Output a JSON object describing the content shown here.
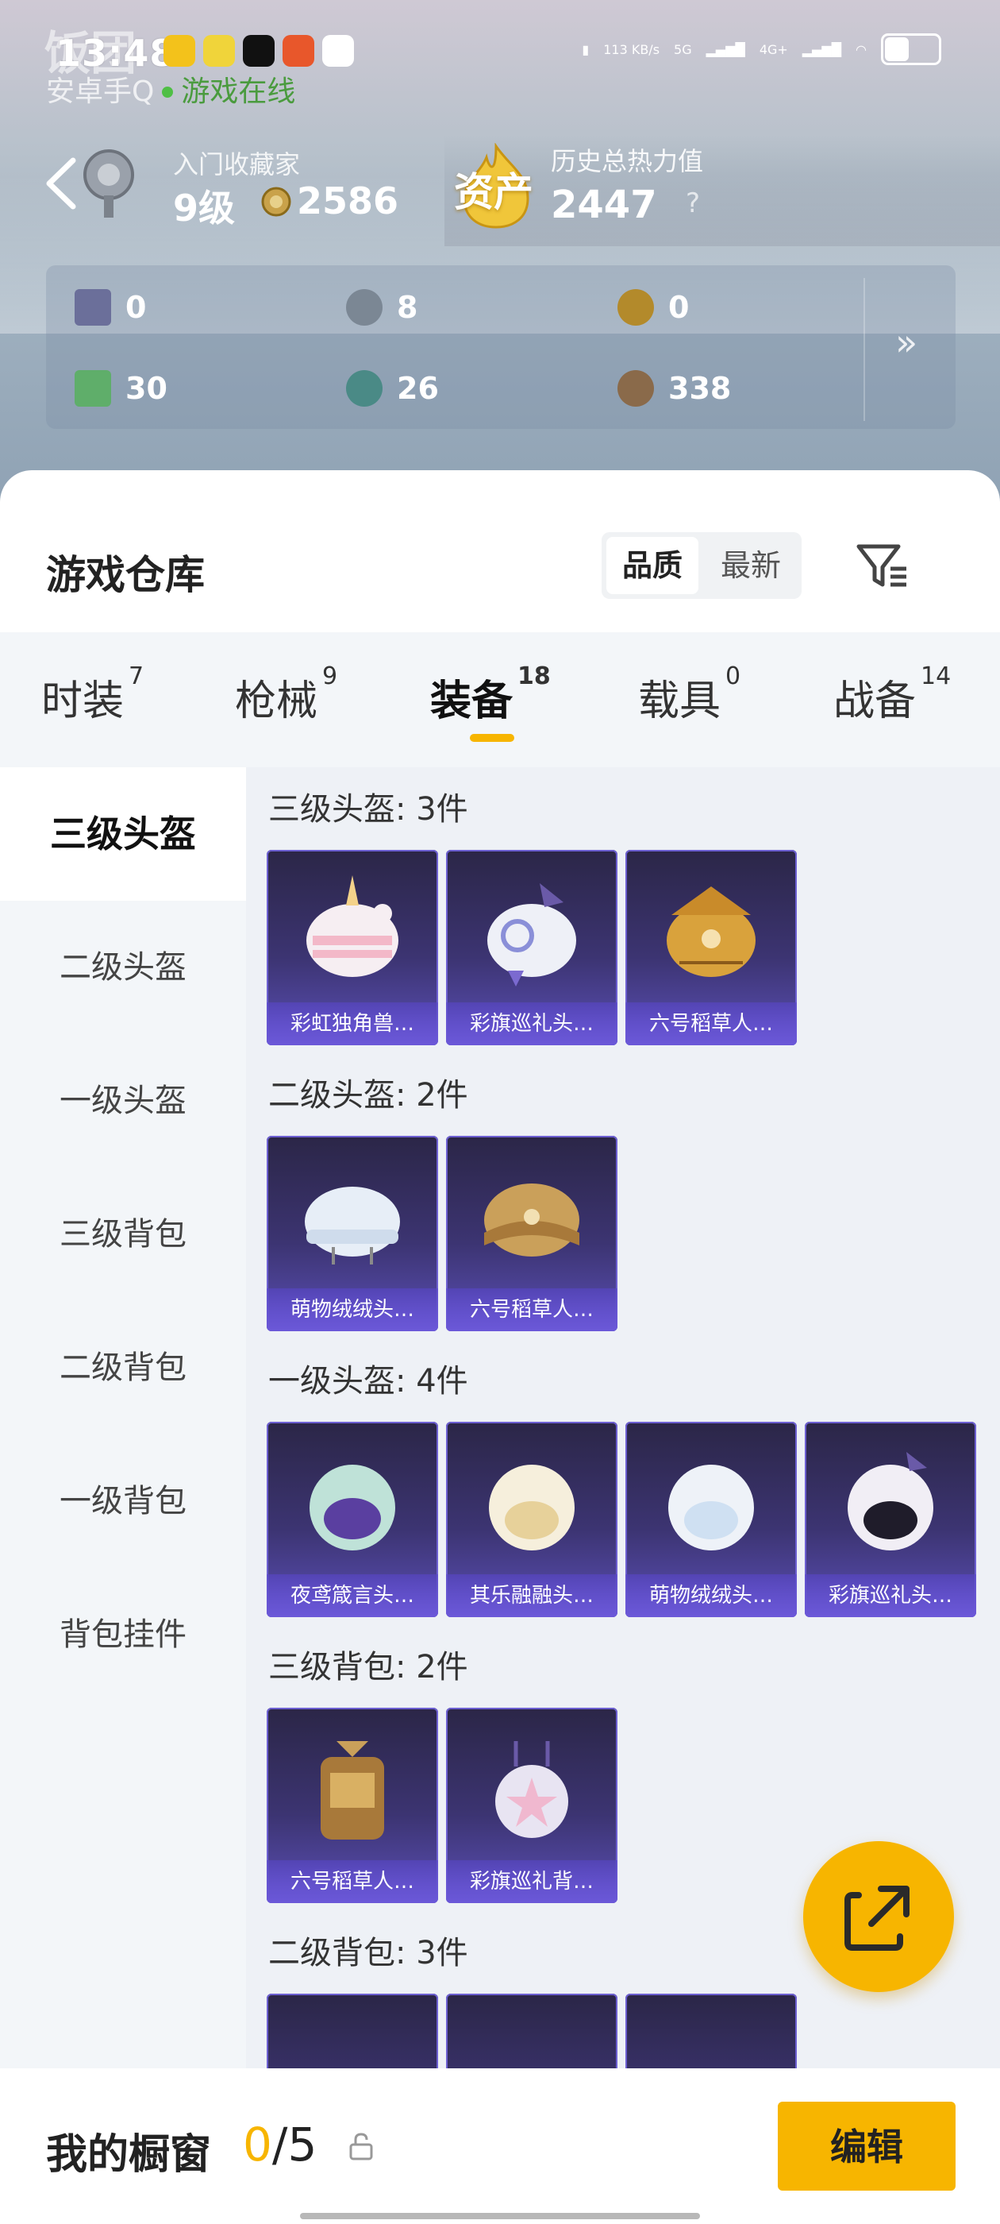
{
  "status_bar": {
    "time": "13:48",
    "watermark": "饭团",
    "net_speed": "113 KB/s",
    "signal_1": "5G",
    "signal_2": "4G+"
  },
  "account": {
    "platform": "安卓手Q",
    "online_status": "游戏在线"
  },
  "header": {
    "collector_title": "入门收藏家",
    "collector_level": "9级",
    "coin_value": "2586",
    "asset_label": "资产",
    "heat_title": "历史总热力值",
    "heat_value": "2447",
    "help": "?"
  },
  "stats": [
    {
      "icon": "card-icon",
      "value": "0",
      "color": "#6b6f9a"
    },
    {
      "icon": "silver-medal-icon",
      "value": "8",
      "color": "#7b8794"
    },
    {
      "icon": "gold-medal-icon",
      "value": "0",
      "color": "#b38a2b"
    },
    {
      "icon": "green-card-icon",
      "value": "30",
      "color": "#5fae6a"
    },
    {
      "icon": "teal-orb-icon",
      "value": "26",
      "color": "#4a8a86"
    },
    {
      "icon": "bronze-coin-icon",
      "value": "338",
      "color": "#8a6a4a"
    }
  ],
  "warehouse": {
    "title": "游戏仓库",
    "sort_options": [
      "品质",
      "最新"
    ]
  },
  "tabs": [
    {
      "label": "时装",
      "count": "7"
    },
    {
      "label": "枪械",
      "count": "9"
    },
    {
      "label": "装备",
      "count": "18"
    },
    {
      "label": "载具",
      "count": "0"
    },
    {
      "label": "战备",
      "count": "14"
    }
  ],
  "sidebar": [
    {
      "label": "三级头盔"
    },
    {
      "label": "二级头盔"
    },
    {
      "label": "一级头盔"
    },
    {
      "label": "三级背包"
    },
    {
      "label": "二级背包"
    },
    {
      "label": "一级背包"
    },
    {
      "label": "背包挂件"
    }
  ],
  "sections": [
    {
      "title": "三级头盔: 3件",
      "items": [
        "彩虹独角兽…",
        "彩旗巡礼头…",
        "六号稻草人…"
      ]
    },
    {
      "title": "二级头盔: 2件",
      "items": [
        "萌物绒绒头…",
        "六号稻草人…"
      ]
    },
    {
      "title": "一级头盔: 4件",
      "items": [
        "夜鸢箴言头…",
        "其乐融融头…",
        "萌物绒绒头…",
        "彩旗巡礼头…"
      ]
    },
    {
      "title": "三级背包: 2件",
      "items": [
        "六号稻草人…",
        "彩旗巡礼背…"
      ]
    },
    {
      "title": "二级背包: 3件",
      "items": []
    }
  ],
  "showcase": {
    "label": "我的橱窗",
    "current": "0",
    "total": "/5",
    "edit_label": "编辑"
  },
  "colors": {
    "accent": "#f7b500",
    "card_top": "#2b2647",
    "card_bottom": "#6b58d8",
    "online": "#4a9b3e"
  }
}
